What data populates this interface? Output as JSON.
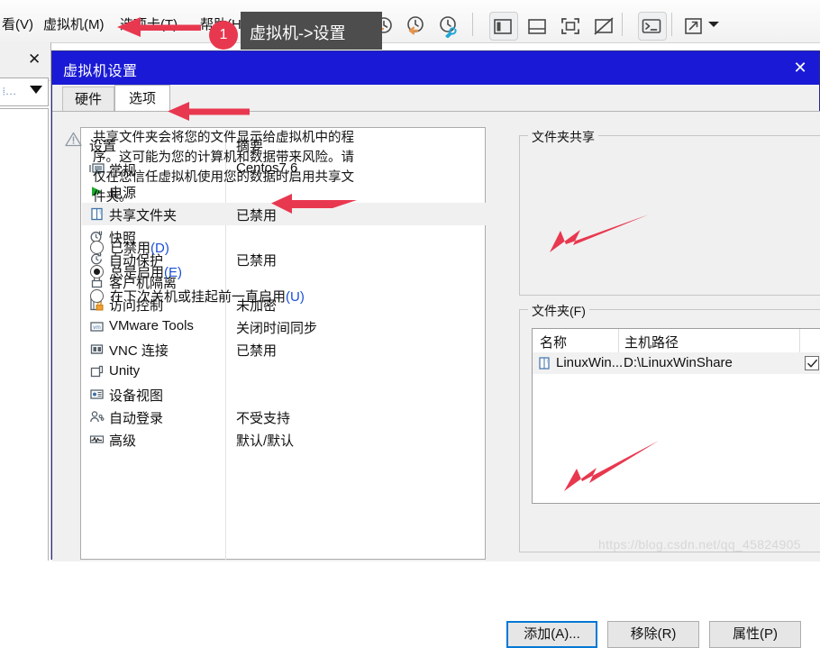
{
  "app": {
    "menus": [
      {
        "name": "menu-view",
        "label": "看(V)"
      },
      {
        "name": "menu-vm",
        "label": "虚拟机(M)"
      },
      {
        "name": "menu-tab",
        "label": "选项卡(T)"
      },
      {
        "name": "menu-help",
        "label": "帮助(H)"
      }
    ],
    "toolbar_icons": [
      "clock-plus-icon",
      "clock-back-icon",
      "clock-wrench-icon",
      "split-pane-icon",
      "bottom-pane-icon",
      "fullscreen-icon",
      "no-screen-icon",
      "console-icon",
      "expand-icon",
      "dropdown-caret-icon"
    ]
  },
  "annotations": {
    "badge_number": "1",
    "tooltip_text": "虚拟机->设置"
  },
  "dialog": {
    "title": "虚拟机设置",
    "close_icon": "✕",
    "tabs": [
      {
        "name": "tab-hardware",
        "label": "硬件",
        "active": false
      },
      {
        "name": "tab-options",
        "label": "选项",
        "active": true
      }
    ],
    "list": {
      "headers": {
        "setting": "设置",
        "summary": "摘要"
      },
      "rows": [
        {
          "icon": "monitor-icon",
          "label": "常规",
          "summary": "Centos7.6",
          "selected": false
        },
        {
          "icon": "play-triangle-icon",
          "label": "电源",
          "summary": "",
          "selected": false
        },
        {
          "icon": "shared-folder-icon",
          "label": "共享文件夹",
          "summary": "已禁用",
          "selected": true
        },
        {
          "icon": "snapshot-clock-icon",
          "label": "快照",
          "summary": "",
          "selected": false
        },
        {
          "icon": "autoprotect-clock-icon",
          "label": "自动保护",
          "summary": "已禁用",
          "selected": false
        },
        {
          "icon": "lock-icon",
          "label": "客户机隔离",
          "summary": "",
          "selected": false
        },
        {
          "icon": "access-control-lock-icon",
          "label": "访问控制",
          "summary": "未加密",
          "selected": false
        },
        {
          "icon": "vmware-tools-icon",
          "label": "VMware Tools",
          "summary": "关闭时间同步",
          "selected": false
        },
        {
          "icon": "vnc-icon",
          "label": "VNC 连接",
          "summary": "已禁用",
          "selected": false
        },
        {
          "icon": "unity-icon",
          "label": "Unity",
          "summary": "",
          "selected": false
        },
        {
          "icon": "device-view-icon",
          "label": "设备视图",
          "summary": "",
          "selected": false
        },
        {
          "icon": "auto-login-icon",
          "label": "自动登录",
          "summary": "不受支持",
          "selected": false
        },
        {
          "icon": "advanced-chart-icon",
          "label": "高级",
          "summary": "默认/默认",
          "selected": false
        }
      ]
    },
    "folder_sharing": {
      "group_title": "文件夹共享",
      "warning_icon": "warning-triangle-icon",
      "warning_text": "共享文件夹会将您的文件显示给虚拟机中的程序。这可能为您的计算机和数据带来风险。请仅在您信任虚拟机使用您的数据时启用共享文件夹。",
      "options": [
        {
          "name": "radio-disabled",
          "label": "已禁用",
          "accel": "(D)",
          "selected": false
        },
        {
          "name": "radio-always-enabled",
          "label": "总是启用",
          "accel": "(E)",
          "selected": true
        },
        {
          "name": "radio-until-shutdown",
          "label": "在下次关机或挂起前一直启用",
          "accel": "(U)",
          "selected": false
        }
      ]
    },
    "folders": {
      "group_title": "文件夹(F)",
      "columns": [
        "名称",
        "主机路径",
        ""
      ],
      "rows": [
        {
          "icon": "shared-folder-icon",
          "name": "LinuxWin...",
          "path": "D:\\LinuxWinShare",
          "checked": true
        }
      ],
      "buttons": [
        {
          "name": "add-button",
          "label": "添加(A)...",
          "focused": true
        },
        {
          "name": "remove-button",
          "label": "移除(R)",
          "focused": false
        },
        {
          "name": "properties-button",
          "label": "属性(P)",
          "focused": false
        }
      ]
    }
  },
  "watermark": "https://blog.csdn.net/qq_45824905",
  "colors": {
    "title_bar": "#1a1ad6",
    "accent_key": "#1a4fd6",
    "annotation_red": "#e8384f",
    "focus_blue": "#0078d7",
    "tooltip_bg": "#4d4d4d"
  }
}
